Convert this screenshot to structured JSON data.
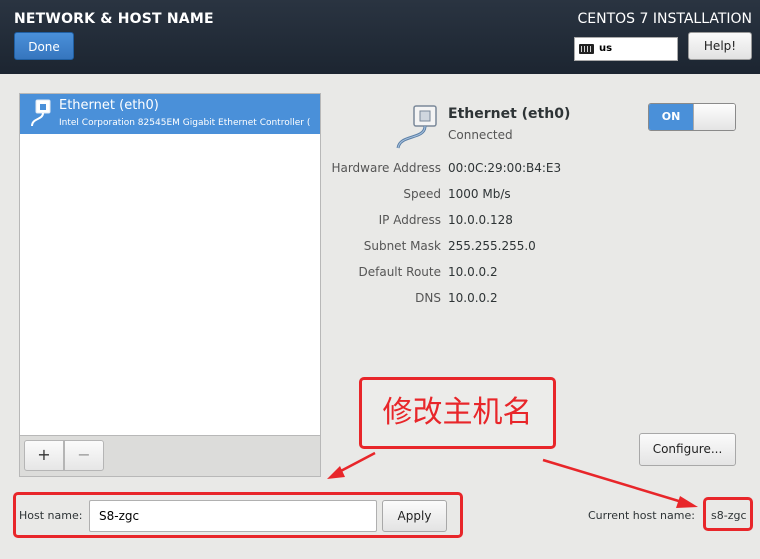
{
  "header": {
    "title": "NETWORK & HOST NAME",
    "done_label": "Done",
    "install_title": "CENTOS 7 INSTALLATION",
    "keyboard_layout": "us",
    "help_label": "Help!"
  },
  "device_list": {
    "items": [
      {
        "name": "Ethernet (eth0)",
        "description": "Intel Corporation 82545EM Gigabit Ethernet Controller (",
        "selected": true
      }
    ],
    "add_label": "+",
    "remove_label": "−"
  },
  "device_detail": {
    "name": "Ethernet (eth0)",
    "status": "Connected",
    "toggle_label": "ON",
    "toggle_on": true,
    "fields": [
      {
        "label": "Hardware Address",
        "value": "00:0C:29:00:B4:E3"
      },
      {
        "label": "Speed",
        "value": "1000 Mb/s"
      },
      {
        "label": "IP Address",
        "value": "10.0.0.128"
      },
      {
        "label": "Subnet Mask",
        "value": "255.255.255.0"
      },
      {
        "label": "Default Route",
        "value": "10.0.0.2"
      },
      {
        "label": "DNS",
        "value": "10.0.0.2"
      }
    ],
    "configure_label": "Configure..."
  },
  "hostname": {
    "label": "Host name:",
    "value": "S8-zgc",
    "apply_label": "Apply",
    "current_label": "Current host name:",
    "current_value": "s8-zgc"
  },
  "annotation": {
    "text": "修改主机名",
    "color": "#e8262a"
  },
  "colors": {
    "accent": "#4a90d9",
    "header_bg": "#222c38",
    "annotation_red": "#e8262a"
  }
}
